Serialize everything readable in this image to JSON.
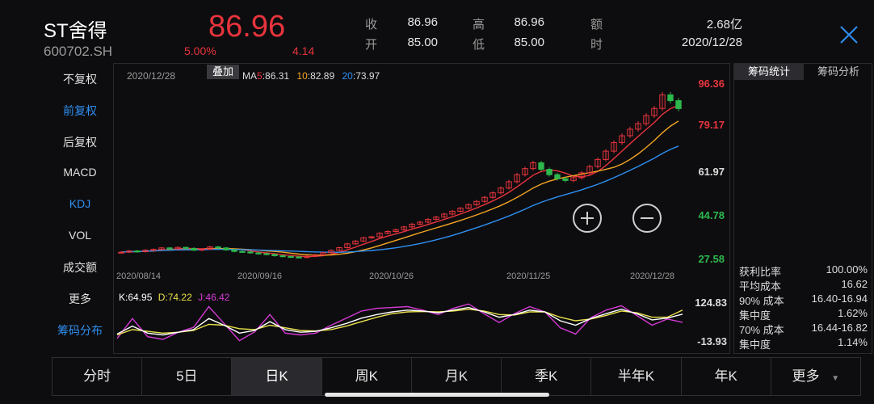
{
  "header": {
    "name": "ST舍得",
    "code": "600702.SH",
    "price": "86.96",
    "change_pct": "5.00%",
    "change": "4.14",
    "quote": [
      {
        "label": "收",
        "value": "86.96"
      },
      {
        "label": "高",
        "value": "86.96"
      },
      {
        "label": "额",
        "value": "2.68亿"
      },
      {
        "label": "开",
        "value": "85.00"
      },
      {
        "label": "低",
        "value": "85.00"
      },
      {
        "label": "时",
        "value": "2020/12/28"
      }
    ]
  },
  "left_menu": {
    "items": [
      {
        "label": "不复权",
        "active": false
      },
      {
        "label": "前复权",
        "active": true
      },
      {
        "label": "后复权",
        "active": false
      },
      {
        "label": "MACD",
        "active": false
      },
      {
        "label": "KDJ",
        "active": true
      },
      {
        "label": "VOL",
        "active": false
      },
      {
        "label": "成交额",
        "active": false
      },
      {
        "label": "更多",
        "active": false
      },
      {
        "label": "筹码分布",
        "active": true
      }
    ]
  },
  "main_chart": {
    "date": "2020/12/28",
    "overlay_label": "叠加",
    "ma_prefix": "MA",
    "ma": [
      {
        "period": "5",
        "sep": ":",
        "value": "86.31",
        "color": "#e8343d"
      },
      {
        "period": "10",
        "sep": ":",
        "value": "82.89",
        "color": "#f5a623"
      },
      {
        "period": "20",
        "sep": ":",
        "value": "73.97",
        "color": "#2f8ff0"
      }
    ],
    "y_labels": [
      {
        "text": "96.36",
        "color": "#e8343d"
      },
      {
        "text": "79.17",
        "color": "#e8343d"
      },
      {
        "text": "61.97",
        "color": "#dcdcdc"
      },
      {
        "text": "44.78",
        "color": "#2db84d"
      },
      {
        "text": "27.58",
        "color": "#2db84d"
      }
    ],
    "x_labels": [
      "2020/08/14",
      "2020/09/16",
      "2020/10/26",
      "2020/11/25",
      "2020/12/28"
    ],
    "zoom_in_icon": "plus-circle-icon",
    "zoom_out_icon": "minus-circle-icon"
  },
  "kdj": {
    "k": "K:64.95",
    "d": "D:74.22",
    "j": "J:46.42",
    "k_color": "#ffffff",
    "d_color": "#e8e04a",
    "j_color": "#d63ad6",
    "y_top": "124.83",
    "y_bottom": "-13.93"
  },
  "right_panel": {
    "tabs": [
      {
        "label": "筹码统计",
        "active": true
      },
      {
        "label": "筹码分析",
        "active": false
      }
    ],
    "stats": [
      {
        "label": "获利比率",
        "value": "100.00%"
      },
      {
        "label": "平均成本",
        "value": "16.62"
      },
      {
        "label": "90% 成本",
        "value": "16.40-16.94"
      },
      {
        "label": "集中度",
        "value": "1.62%"
      },
      {
        "label": "70% 成本",
        "value": "16.44-16.82"
      },
      {
        "label": "集中度",
        "value": "1.14%"
      }
    ]
  },
  "bottom_tabs": [
    {
      "label": "分时",
      "active": false
    },
    {
      "label": "5日",
      "active": false
    },
    {
      "label": "日K",
      "active": true
    },
    {
      "label": "周K",
      "active": false
    },
    {
      "label": "月K",
      "active": false
    },
    {
      "label": "季K",
      "active": false
    },
    {
      "label": "半年K",
      "active": false
    },
    {
      "label": "年K",
      "active": false
    },
    {
      "label": "更多",
      "active": false
    }
  ],
  "chart_data": {
    "type": "candlestick",
    "y_range": [
      27.58,
      96.36
    ],
    "x_ticks": [
      "2020/08/14",
      "2020/09/16",
      "2020/10/26",
      "2020/11/25",
      "2020/12/28"
    ],
    "series_close": [
      30.1,
      30.6,
      30.3,
      30.9,
      31.2,
      31.8,
      31.4,
      32.0,
      31.6,
      30.9,
      31.3,
      32.2,
      31.8,
      31.0,
      30.4,
      30.2,
      29.8,
      29.5,
      29.2,
      28.7,
      28.4,
      28.2,
      28.0,
      28.5,
      29.1,
      29.9,
      30.8,
      31.9,
      33.4,
      34.5,
      35.8,
      36.2,
      37.6,
      38.3,
      39.0,
      40.1,
      41.2,
      42.0,
      43.1,
      44.0,
      45.2,
      46.3,
      47.5,
      48.9,
      50.2,
      51.8,
      53.6,
      55.5,
      58.0,
      60.8,
      63.2,
      65.5,
      62.9,
      60.8,
      59.2,
      58.5,
      59.6,
      61.5,
      64.0,
      66.8,
      70.1,
      73.5,
      76.2,
      78.8,
      81.0,
      84.2,
      87.0,
      92.4,
      90.1,
      86.96
    ],
    "kdj_range": [
      -13.93,
      124.83
    ],
    "K": [
      20,
      38,
      22,
      18,
      24,
      30,
      55,
      40,
      22,
      28,
      48,
      30,
      24,
      26,
      34,
      44,
      56,
      64,
      70,
      74,
      72,
      68,
      74,
      80,
      70,
      58,
      64,
      74,
      70,
      50,
      40,
      55,
      66,
      76,
      66,
      52,
      56,
      64.95
    ],
    "D": [
      18,
      30,
      26,
      22,
      24,
      28,
      42,
      40,
      32,
      30,
      40,
      34,
      28,
      27,
      30,
      38,
      48,
      58,
      66,
      70,
      71,
      70,
      72,
      76,
      72,
      64,
      63,
      70,
      70,
      58,
      50,
      54,
      62,
      72,
      68,
      58,
      58,
      74.22
    ],
    "J": [
      10,
      55,
      14,
      8,
      24,
      35,
      82,
      44,
      5,
      25,
      64,
      22,
      18,
      22,
      40,
      56,
      72,
      78,
      80,
      82,
      74,
      64,
      78,
      88,
      66,
      46,
      66,
      82,
      70,
      34,
      20,
      57,
      74,
      84,
      62,
      40,
      54,
      46.42
    ]
  }
}
